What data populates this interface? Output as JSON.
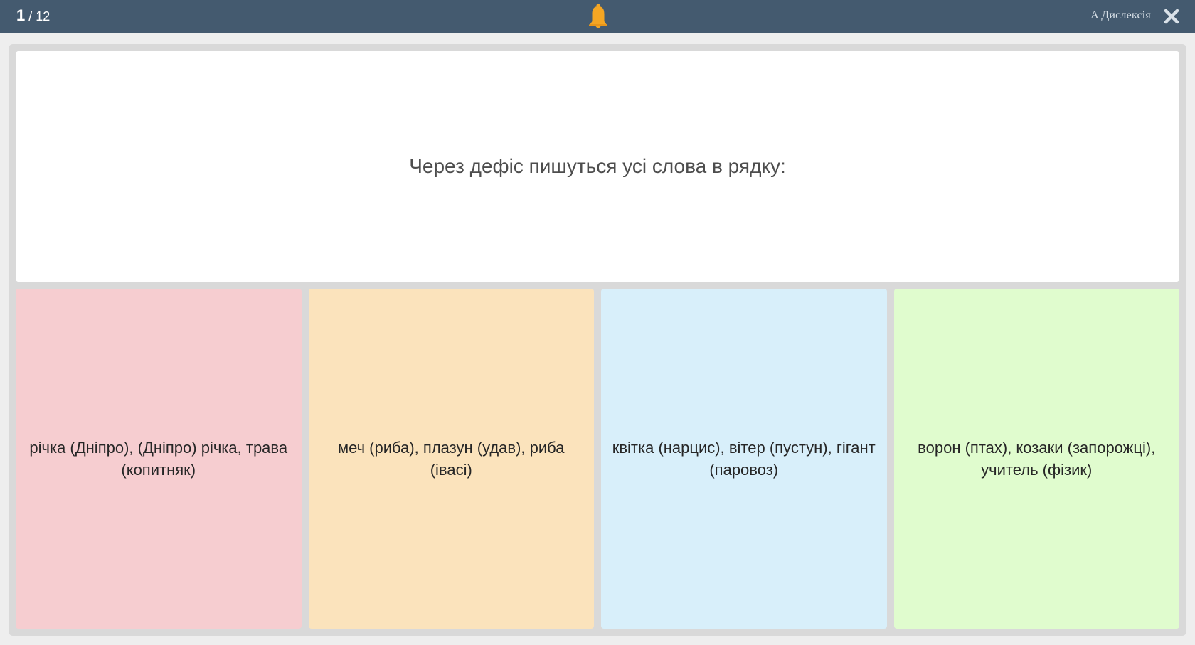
{
  "header": {
    "current": "1",
    "total": " / 12",
    "bell_icon": "bell-icon",
    "dyslexia_label": "A Дислексія",
    "close_icon": "close-icon"
  },
  "question": {
    "text": "Через дефіс пишуться усі слова в рядку:"
  },
  "answers": [
    {
      "text": "річка (Дніпро), (Дніпро) річка, трава (копитняк)",
      "color": "#f6cdd0"
    },
    {
      "text": "меч (риба), плазун (удав), риба (івасі)",
      "color": "#fbe3bc"
    },
    {
      "text": "квітка (нарцис), вітер (пустун), гігант (паровоз)",
      "color": "#d8effa"
    },
    {
      "text": "ворон (птах), козаки (запорожці), учитель (фізик)",
      "color": "#e0fcce"
    }
  ],
  "colors": {
    "topbar": "#445a6f",
    "bell": "#f5a623"
  }
}
